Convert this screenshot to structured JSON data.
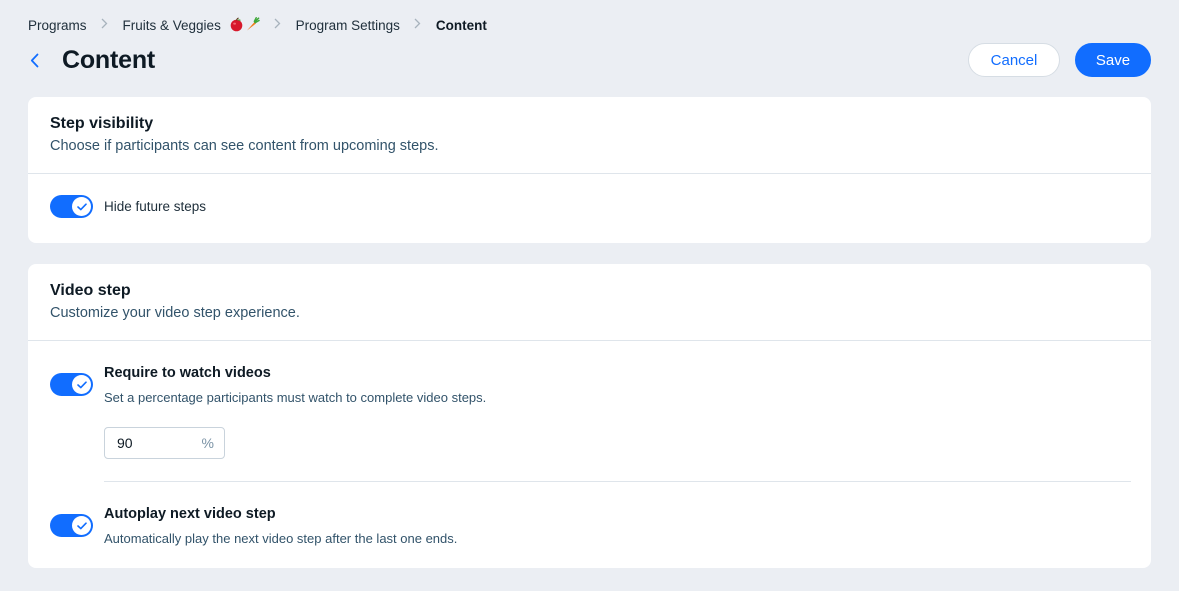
{
  "breadcrumb": {
    "items": [
      "Programs",
      "Fruits & Veggies",
      "Program Settings",
      "Content"
    ],
    "emoji_icons": [
      "apple-icon",
      "carrot-icon"
    ]
  },
  "header": {
    "title": "Content",
    "cancel_label": "Cancel",
    "save_label": "Save"
  },
  "step_visibility": {
    "title": "Step visibility",
    "subtitle": "Choose if participants can see content from upcoming steps.",
    "hide_future_steps": {
      "label": "Hide future steps",
      "enabled": true
    }
  },
  "video_step": {
    "title": "Video step",
    "subtitle": "Customize your video step experience.",
    "require_watch": {
      "title": "Require to watch videos",
      "description": "Set a percentage participants must watch to complete video steps.",
      "enabled": true,
      "percentage_value": "90",
      "percentage_suffix": "%"
    },
    "autoplay": {
      "title": "Autoplay next video step",
      "description": "Automatically play the next video step after the last one ends.",
      "enabled": true
    }
  },
  "colors": {
    "accent": "#116dff",
    "background": "#ebeef3",
    "card": "#ffffff"
  }
}
